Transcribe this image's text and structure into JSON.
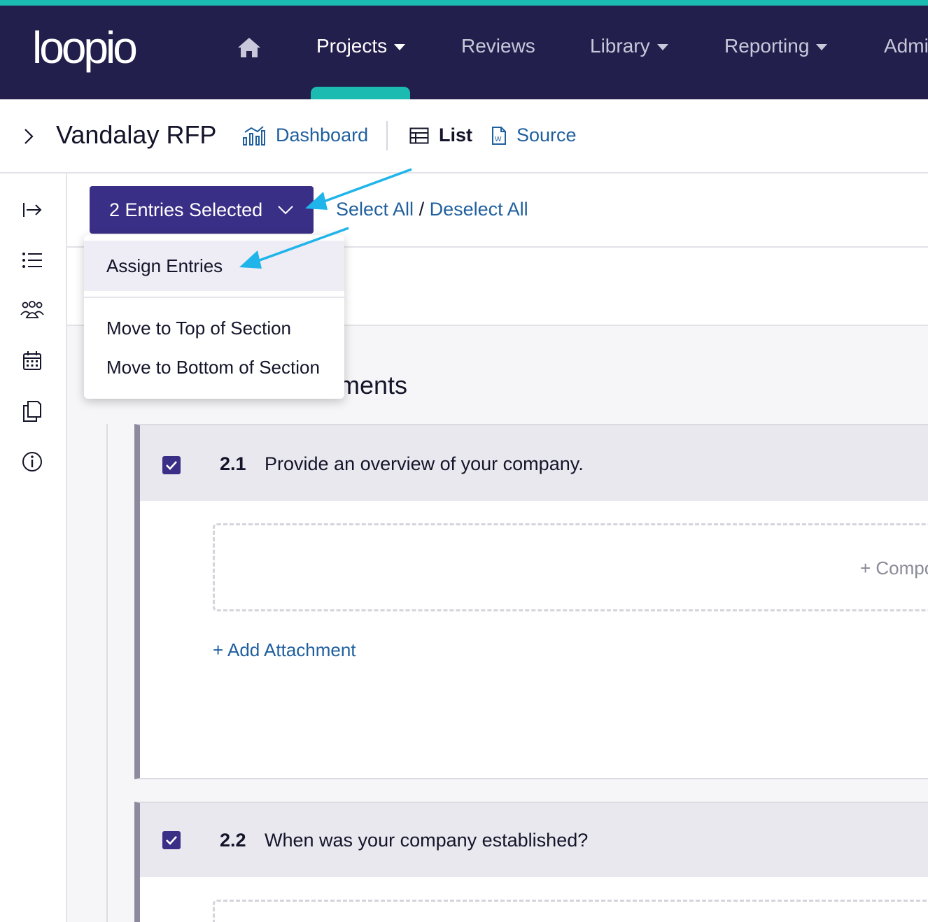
{
  "topnav": {
    "logo": "loopio",
    "items": [
      {
        "label": "Projects",
        "has_caret": true,
        "active": true
      },
      {
        "label": "Reviews",
        "has_caret": false
      },
      {
        "label": "Library",
        "has_caret": true
      },
      {
        "label": "Reporting",
        "has_caret": true
      },
      {
        "label": "Admi",
        "has_caret": false
      }
    ],
    "home_icon": "home-icon",
    "accent_color": "#1bbbb2",
    "bg_color": "#231f4d"
  },
  "header": {
    "project_title": "Vandalay RFP",
    "links": {
      "dashboard": "Dashboard",
      "list": "List",
      "source": "Source"
    }
  },
  "rail": {
    "icons": [
      "expand-icon",
      "list-icon",
      "team-icon",
      "calendar-icon",
      "copy-icon",
      "info-icon"
    ]
  },
  "toolbar": {
    "entries_selected": "2 Entries Selected",
    "select_all": "Select All",
    "separator": "/",
    "deselect_all": "Deselect All",
    "button_color": "#3a2f86"
  },
  "dropdown": {
    "items": [
      "Assign Entries",
      "Move to Top of Section",
      "Move to Bottom of Section"
    ]
  },
  "section": {
    "title_visible": "ements"
  },
  "entries": [
    {
      "number": "2.1",
      "question": "Provide an overview of your company.",
      "checked": true,
      "compose": "+ Compo"
    },
    {
      "number": "2.2",
      "question": "When was your company established?",
      "checked": true
    }
  ],
  "add_attachment": "+ Add Attachment"
}
